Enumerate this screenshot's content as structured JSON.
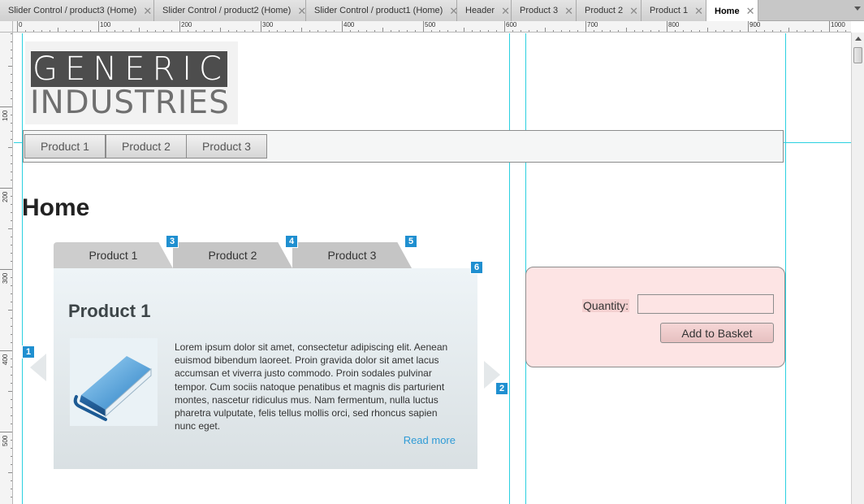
{
  "tabs": [
    {
      "label": "Slider Control / product3 (Home)",
      "active": false
    },
    {
      "label": "Slider Control / product2 (Home)",
      "active": false
    },
    {
      "label": "Slider Control / product1 (Home)",
      "active": false
    },
    {
      "label": "Header",
      "active": false
    },
    {
      "label": "Product 3",
      "active": false
    },
    {
      "label": "Product 2",
      "active": false
    },
    {
      "label": "Product 1",
      "active": false
    },
    {
      "label": "Home",
      "active": true
    }
  ],
  "tab_close_glyph": "✕",
  "ruler": {
    "h_labels": [
      "0",
      "100",
      "200",
      "300",
      "400",
      "500",
      "600",
      "700",
      "800",
      "900",
      "1000"
    ],
    "v_labels": [
      "100",
      "200",
      "300",
      "400",
      "500"
    ]
  },
  "logo": {
    "line1": "GENERIC",
    "line2": "INDUSTRIES"
  },
  "nav": {
    "items": [
      "Product 1",
      "Product 2",
      "Product 3"
    ]
  },
  "page": {
    "title": "Home"
  },
  "slider": {
    "tabs": [
      "Product 1",
      "Product 2",
      "Product 3"
    ],
    "panel_title": "Product 1",
    "body": "Lorem ipsum dolor sit amet, consectetur adipiscing elit. Aenean euismod bibendum laoreet. Proin gravida dolor sit amet lacus accumsan et viverra justo commodo. Proin sodales pulvinar tempor. Cum sociis natoque penatibus et magnis dis parturient montes, nascetur ridiculus mus. Nam fermentum, nulla luctus pharetra vulputate, felis tellus mollis orci, sed rhoncus sapien nunc eget.",
    "read_more": "Read more",
    "image_icon": "book-icon"
  },
  "badges": [
    "1",
    "2",
    "3",
    "4",
    "5",
    "6"
  ],
  "basket": {
    "quantity_label": "Quantity:",
    "quantity_value": "",
    "button_label": "Add to Basket"
  },
  "colors": {
    "guide": "#2ad0e0",
    "badge": "#1f8fd0",
    "link": "#2f9bd6",
    "basket_bg": "#fde4e4"
  }
}
